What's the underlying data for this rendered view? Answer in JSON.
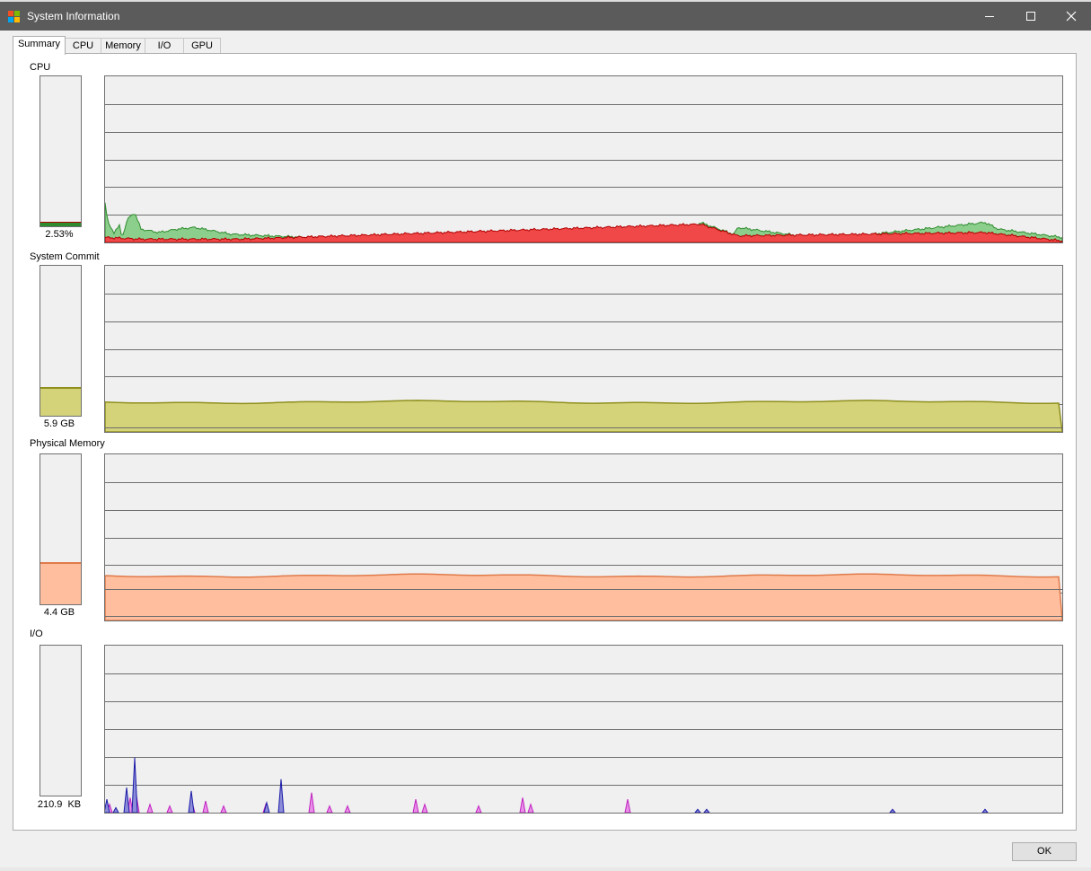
{
  "window": {
    "title": "System Information",
    "minimize_glyph": "minimize-icon",
    "maximize_glyph": "maximize-icon",
    "close_glyph": "close-icon"
  },
  "tabs": [
    {
      "label": "Summary",
      "active": true
    },
    {
      "label": "CPU",
      "active": false
    },
    {
      "label": "Memory",
      "active": false
    },
    {
      "label": "I/O",
      "active": false
    },
    {
      "label": "GPU",
      "active": false
    }
  ],
  "sections": {
    "cpu": {
      "label": "CPU",
      "value": "2.53%",
      "level": 0.0253
    },
    "commit": {
      "label": "System Commit",
      "value": "5.9 GB",
      "level": 0.18
    },
    "physical": {
      "label": "Physical Memory",
      "value": "4.4 GB",
      "level": 0.27
    },
    "io": {
      "label": "I/O",
      "value": "210.9  KB",
      "level": 0.0
    }
  },
  "buttons": {
    "ok": "OK"
  },
  "colors": {
    "cpu_total_fill": "#8ccf8c",
    "cpu_total_line": "#2e8b2e",
    "cpu_kernel_fill": "#f04848",
    "cpu_kernel_line": "#b00000",
    "commit_fill": "#d4d37a",
    "commit_line": "#8f8f1e",
    "physical_fill": "#ffbf9f",
    "physical_line": "#e07a4a",
    "io_read_line": "#1a1aa8",
    "io_read_fill": "#8c8cd8",
    "io_write_line": "#c020c0",
    "io_write_fill": "#e890e8",
    "grid": "#6e6e6e"
  },
  "history": {
    "cpu_total_peaks": [
      [
        0,
        0.24
      ],
      [
        3,
        0.12
      ],
      [
        10,
        0.06
      ],
      [
        16,
        0.1
      ],
      [
        19,
        0.03
      ],
      [
        25,
        0.14
      ],
      [
        33,
        0.18
      ],
      [
        40,
        0.08
      ],
      [
        60,
        0.06
      ],
      [
        80,
        0.08
      ],
      [
        100,
        0.09
      ],
      [
        140,
        0.05
      ],
      [
        180,
        0.04
      ],
      [
        230,
        0.03
      ],
      [
        300,
        0.02
      ],
      [
        500,
        0.02
      ],
      [
        640,
        0.03
      ],
      [
        663,
        0.12
      ],
      [
        700,
        0.05
      ],
      [
        705,
        0.09
      ],
      [
        800,
        0.02
      ],
      [
        980,
        0.12
      ],
      [
        995,
        0.08
      ],
      [
        1066,
        0.03
      ]
    ],
    "cpu_kernel_peaks": [
      [
        0,
        0.03
      ],
      [
        40,
        0.02
      ],
      [
        150,
        0.02
      ],
      [
        663,
        0.11
      ],
      [
        705,
        0.04
      ],
      [
        980,
        0.06
      ],
      [
        1066,
        0.01
      ]
    ],
    "commit_level": 0.18,
    "physical_level": 0.27,
    "io_read_spikes": [
      [
        2,
        0.08
      ],
      [
        12,
        0.03
      ],
      [
        24,
        0.15
      ],
      [
        33,
        0.33
      ],
      [
        96,
        0.13
      ],
      [
        180,
        0.06
      ],
      [
        196,
        0.2
      ],
      [
        660,
        0.02
      ],
      [
        670,
        0.02
      ],
      [
        877,
        0.02
      ],
      [
        980,
        0.02
      ]
    ],
    "io_write_spikes": [
      [
        5,
        0.05
      ],
      [
        28,
        0.09
      ],
      [
        35,
        0.1
      ],
      [
        50,
        0.05
      ],
      [
        72,
        0.04
      ],
      [
        97,
        0.06
      ],
      [
        112,
        0.07
      ],
      [
        132,
        0.04
      ],
      [
        179,
        0.05
      ],
      [
        196,
        0.12
      ],
      [
        230,
        0.12
      ],
      [
        250,
        0.04
      ],
      [
        270,
        0.04
      ],
      [
        346,
        0.08
      ],
      [
        356,
        0.05
      ],
      [
        416,
        0.04
      ],
      [
        465,
        0.09
      ],
      [
        474,
        0.05
      ],
      [
        582,
        0.08
      ]
    ]
  }
}
